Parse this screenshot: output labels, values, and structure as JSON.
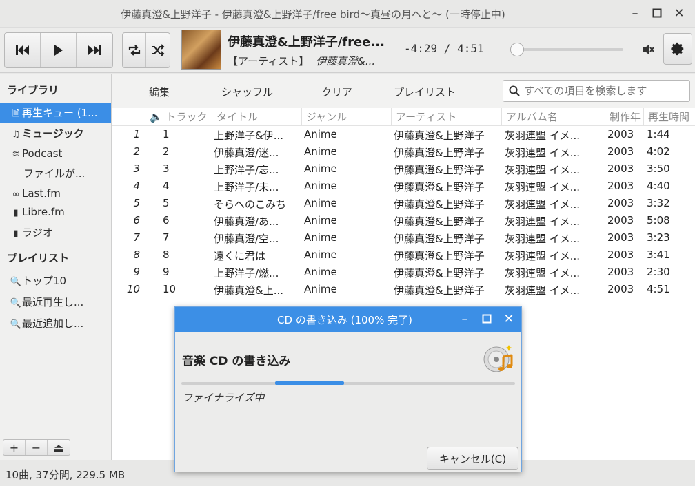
{
  "window": {
    "title": "伊藤真澄&上野洋子 - 伊藤真澄&上野洋子/free bird〜真昼の月へと〜 (一時停止中)"
  },
  "now_playing": {
    "title": "伊藤真澄&上野洋子/free...",
    "artist_label": "【アーティスト】",
    "artist": "伊藤真澄&...",
    "time": "-4:29 / 4:51",
    "seek_fraction": 0.0
  },
  "sidebar": {
    "library_header": "ライブラリ",
    "library_items": [
      {
        "label": "再生キュー (1...",
        "icon": "document-icon",
        "selected": true
      },
      {
        "label": "ミュージック",
        "icon": "music-note-icon",
        "bold": true
      },
      {
        "label": "Podcast",
        "icon": "rss-icon"
      },
      {
        "label": "ファイルが...",
        "icon": ""
      },
      {
        "label": "Last.fm",
        "icon": "lastfm-icon"
      },
      {
        "label": "Libre.fm",
        "icon": "radio-icon"
      },
      {
        "label": "ラジオ",
        "icon": "radio-icon"
      }
    ],
    "playlist_header": "プレイリスト",
    "playlist_items": [
      {
        "label": "トップ10",
        "icon": "search-icon"
      },
      {
        "label": "最近再生し...",
        "icon": "search-icon"
      },
      {
        "label": "最近追加し...",
        "icon": "search-icon"
      }
    ],
    "actions": [
      "+",
      "−",
      "⏏"
    ]
  },
  "actions": {
    "edit": "編集",
    "shuffle": "シャッフル",
    "clear": "クリア",
    "playlist": "プレイリスト",
    "search_placeholder": "すべての項目を検索します"
  },
  "table": {
    "columns": [
      "トラック",
      "タイトル",
      "ジャンル",
      "アーティスト",
      "アルバム名",
      "制作年",
      "再生時間"
    ],
    "rows": [
      {
        "n": "1",
        "track": "1",
        "title": "上野洋子&伊...",
        "genre": "Anime",
        "artist": "伊藤真澄&上野洋子",
        "album": "灰羽連盟 イメ...",
        "year": "2003",
        "length": "1:44"
      },
      {
        "n": "2",
        "track": "2",
        "title": "伊藤真澄/迷...",
        "genre": "Anime",
        "artist": "伊藤真澄&上野洋子",
        "album": "灰羽連盟 イメ...",
        "year": "2003",
        "length": "4:02"
      },
      {
        "n": "3",
        "track": "3",
        "title": "上野洋子/忘...",
        "genre": "Anime",
        "artist": "伊藤真澄&上野洋子",
        "album": "灰羽連盟 イメ...",
        "year": "2003",
        "length": "3:50"
      },
      {
        "n": "4",
        "track": "4",
        "title": "上野洋子/未...",
        "genre": "Anime",
        "artist": "伊藤真澄&上野洋子",
        "album": "灰羽連盟 イメ...",
        "year": "2003",
        "length": "4:40"
      },
      {
        "n": "5",
        "track": "5",
        "title": "そらへのこみち",
        "genre": "Anime",
        "artist": "伊藤真澄&上野洋子",
        "album": "灰羽連盟 イメ...",
        "year": "2003",
        "length": "3:32"
      },
      {
        "n": "6",
        "track": "6",
        "title": "伊藤真澄/あ...",
        "genre": "Anime",
        "artist": "伊藤真澄&上野洋子",
        "album": "灰羽連盟 イメ...",
        "year": "2003",
        "length": "5:08"
      },
      {
        "n": "7",
        "track": "7",
        "title": "伊藤真澄/空...",
        "genre": "Anime",
        "artist": "伊藤真澄&上野洋子",
        "album": "灰羽連盟 イメ...",
        "year": "2003",
        "length": "3:23"
      },
      {
        "n": "8",
        "track": "8",
        "title": "遠くに君は",
        "genre": "Anime",
        "artist": "伊藤真澄&上野洋子",
        "album": "灰羽連盟 イメ...",
        "year": "2003",
        "length": "3:41"
      },
      {
        "n": "9",
        "track": "9",
        "title": "上野洋子/燃...",
        "genre": "Anime",
        "artist": "伊藤真澄&上野洋子",
        "album": "灰羽連盟 イメ...",
        "year": "2003",
        "length": "2:30"
      },
      {
        "n": "10",
        "track": "10",
        "title": "伊藤真澄&上...",
        "genre": "Anime",
        "artist": "伊藤真澄&上野洋子",
        "album": "灰羽連盟 イメ...",
        "year": "2003",
        "length": "4:51"
      }
    ]
  },
  "status": {
    "summary": "10曲, 37分間, 229.5 MB"
  },
  "dialog": {
    "title": "CD の書き込み (100% 完了)",
    "heading": "音楽 CD の書き込み",
    "status": "ファイナライズ中",
    "cancel": "キャンセル(C)",
    "accent": "#3b8ee6"
  }
}
